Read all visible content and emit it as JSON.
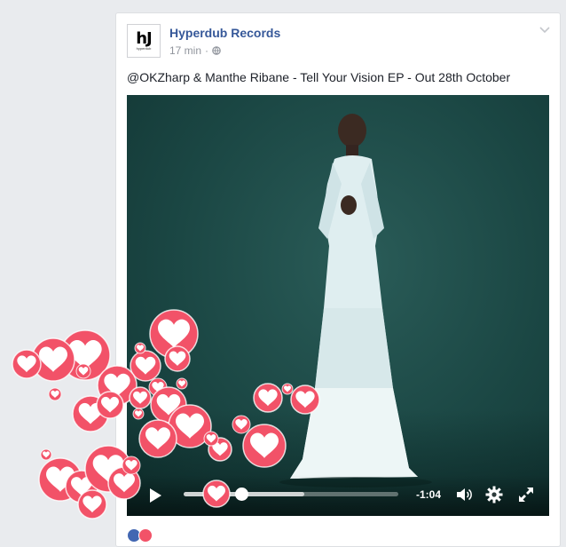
{
  "post": {
    "page_name": "Hyperdub Records",
    "timestamp": "17 min",
    "separator": "·",
    "text": "@OKZharp & Manthe Ribane - Tell Your Vision EP - Out 28th October",
    "avatar_mark": "hJ",
    "avatar_small": "hyperdub"
  },
  "video": {
    "time_remaining": "-1:04",
    "progress": 0.27,
    "buffered": 0.56
  },
  "icons": [
    "globe-icon",
    "chevron-down-icon",
    "play-icon",
    "volume-icon",
    "settings-gear-icon",
    "fullscreen-icon",
    "heart-icon"
  ],
  "colors": {
    "link": "#365899",
    "heart": "#f25268",
    "video_bg": "#1b4744"
  }
}
